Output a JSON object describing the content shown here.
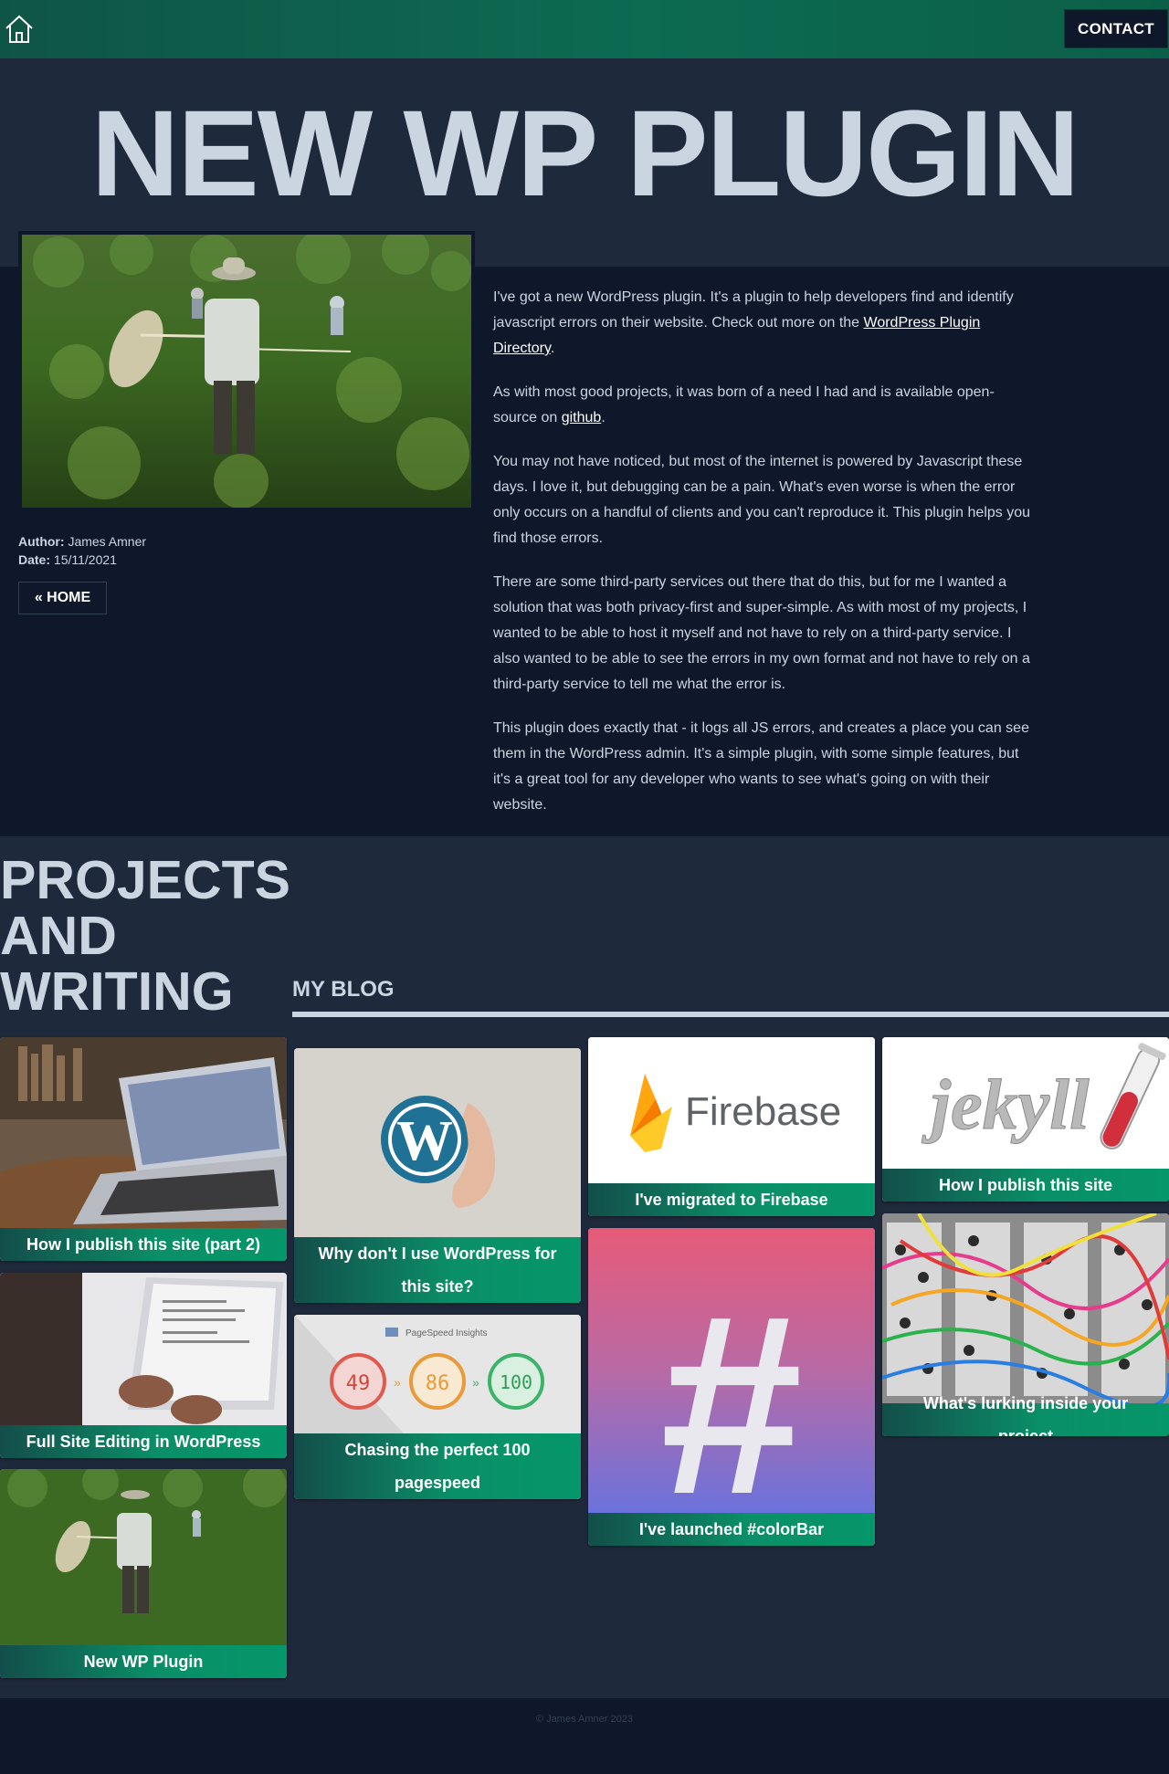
{
  "nav": {
    "home_icon": "house-icon",
    "contact_label": "CONTACT"
  },
  "hero": {
    "title": "NEW WP PLUGIN"
  },
  "article": {
    "author_label": "Author:",
    "author": "James Amner",
    "date_label": "Date:",
    "date": "15/11/2021",
    "home_button": "« HOME",
    "p1_a": "I've got a new WordPress plugin. It's a plugin to help developers find and identify javascript errors on their website. Check out more on the ",
    "p1_link": "WordPress Plugin Directory",
    "p1_b": ".",
    "p2_a": "As with most good projects, it was born of a need I had and is available open-source on ",
    "p2_link": "github",
    "p2_b": ".",
    "p3": "You may not have noticed, but most of the internet is powered by Javascript these days. I love it, but debugging can be a pain. What's even worse is when the error only occurs on a handful of clients and you can't reproduce it. This plugin helps you find those errors.",
    "p4": "There are some third-party services out there that do this, but for me I wanted a solution that was both privacy-first and super-simple. As with most of my projects, I wanted to be able to host it myself and not have to rely on a third-party service. I also wanted to be able to see the errors in my own format and not have to rely on a third-party service to tell me what the error is.",
    "p5": "This plugin does exactly that - it logs all JS errors, and creates a place you can see them in the WordPress admin. It's a simple plugin, with some simple features, but it's a great tool for any developer who wants to see what's going on with their website."
  },
  "projects": {
    "title_line1": "PROJECTS",
    "title_line2": "AND",
    "title_line3": "WRITING",
    "blog_heading": "MY BLOG",
    "cards": {
      "publish2": "How I publish this site (part 2)",
      "fse": "Full Site Editing in WordPress",
      "wpplugin": "New WP Plugin",
      "why_wp": "Why don't I use WordPress for this site?",
      "pagespeed": "Chasing the perfect 100 pagespeed",
      "firebase": "I've migrated to Firebase",
      "colorbar": "I've launched #colorBar",
      "publish": "How I publish this site",
      "lurking": "What's lurking inside your project"
    },
    "firebase_logo_text": "Firebase",
    "jekyll_logo_text": "jekyll",
    "pagespeed_logo_text": "PageSpeed Insights",
    "pagespeed_scores": [
      "49",
      "86",
      "100"
    ],
    "colorbar_symbol": "#"
  },
  "footer": {
    "copyright": "© James Amner 2023"
  },
  "colors": {
    "background": "#1e293b",
    "dark": "#0f172a",
    "accent_green": "#059669",
    "text": "#cbd5e1"
  }
}
